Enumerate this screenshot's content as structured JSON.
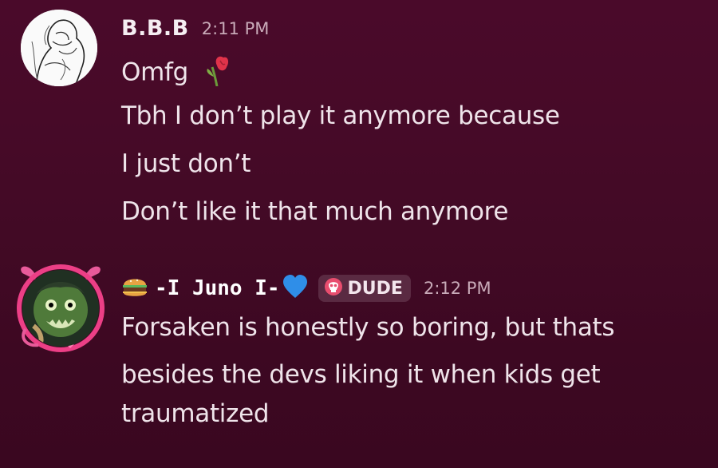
{
  "messages": [
    {
      "username": "B.B.B",
      "timestamp": "2:11 PM",
      "lines": [
        "Omfg",
        "Tbh I don’t play it anymore because",
        "I just don’t",
        "Don’t like it that much anymore"
      ],
      "avatar_icon": "sketch-avatar",
      "inline_emoji": "wilted-rose-emoji"
    },
    {
      "username": "-I Juno I-",
      "timestamp": "2:12 PM",
      "name_prefix_emoji": "burger-emoji",
      "name_suffix_emoji": "blue-heart-emoji",
      "tag": {
        "icon": "skull-icon",
        "label": "DUDE"
      },
      "lines": [
        "Forsaken is honestly so boring, but thats",
        "besides the devs liking it when kids get",
        "traumatized"
      ],
      "avatar_icon": "zombie-avatar-with-heart-frame"
    }
  ]
}
